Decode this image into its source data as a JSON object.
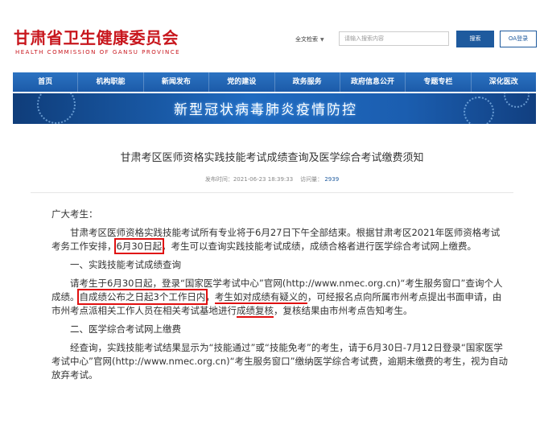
{
  "header": {
    "logo_cn": "甘肃省卫生健康委员会",
    "logo_en": "HEALTH COMMISSION OF GANSU PROVINCE",
    "search_scope": "全文检索",
    "search_placeholder": "请输入搜索内容",
    "search_button": "搜索",
    "oa_button": "OA登录"
  },
  "nav": [
    "首页",
    "机构职能",
    "新闻发布",
    "党的建设",
    "政务服务",
    "政府信息公开",
    "专题专栏",
    "深化医改"
  ],
  "banner_text": "新型冠状病毒肺炎疫情防控",
  "article": {
    "title": "甘肃考区医师资格实践技能考试成绩查询及医学综合考试缴费须知",
    "publish_label": "发布时间：",
    "publish_time": "2021-06-23 18:39:33",
    "views_label": "访问量：",
    "views": "2939",
    "greeting": "广大考生：",
    "p1_a": "甘肃考区医师资格实践技能考试所有专业将于6月27日下午全部结束。根据甘肃考区2021年医师资格考试考务工作安排，",
    "p1_hl": "6月30日起",
    "p1_b": "，考生可以查询实践技能考试成绩，成绩合格者进行医学综合考试网上缴费。",
    "h1": "一、实践技能考试成绩查询",
    "p2_a": "请考生于6月30日起，登录“国家医学考试中心”官网(http://www.nmec.org.cn)“考生服务窗口”查询个人成绩。",
    "p2_hl": "自成绩公布之日起3个工作日内",
    "p2_b": "，",
    "p2_ul1": "考生如对成绩有疑义的",
    "p2_c": "，可经报名点向所属市州考点提出书面申请，由市州考点派相关工作人员在相关考试基地进行",
    "p2_ul2": "成绩复核",
    "p2_d": "，复核结果由市州考点告知考生。",
    "h2": "二、医学综合考试网上缴费",
    "p3": "经查询，实践技能考试结果显示为“技能通过”或“技能免考”的考生，请于6月30日-7月12日登录“国家医学考试中心”官网(http://www.nmec.org.cn)“考生服务窗口”缴纳医学综合考试费，逾期未缴费的考生，视为自动放弃考试。"
  }
}
